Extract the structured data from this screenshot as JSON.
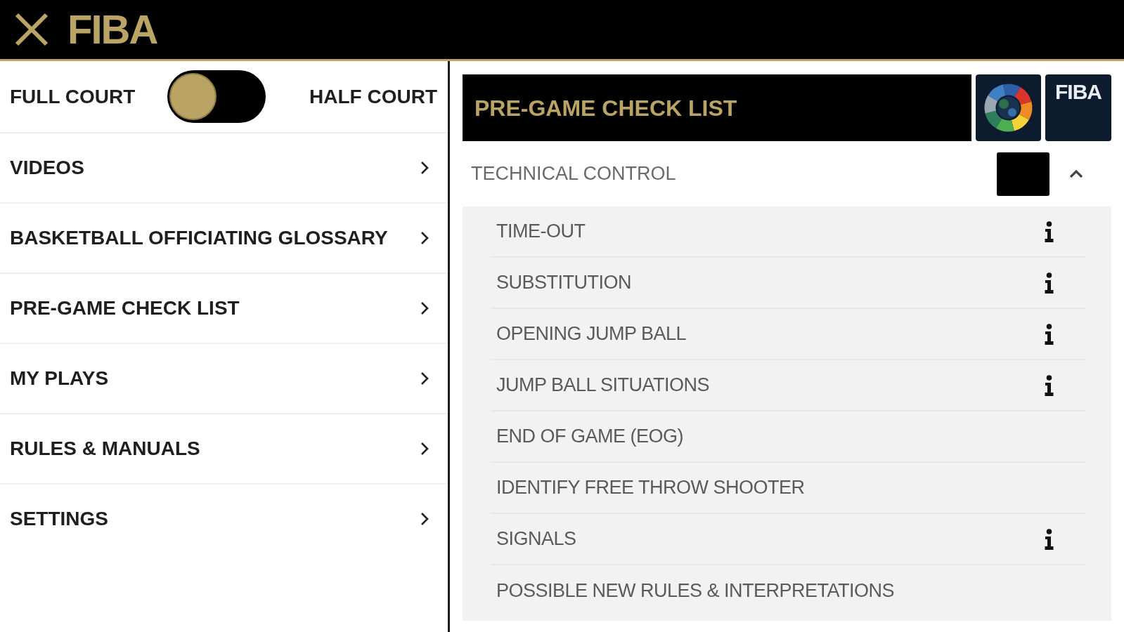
{
  "header": {
    "logo_text": "FIBA"
  },
  "court_toggle": {
    "left_label": "FULL COURT",
    "right_label": "HALF COURT",
    "on": false
  },
  "menu": [
    {
      "label": "VIDEOS"
    },
    {
      "label": "BASKETBALL OFFICIATING GLOSSARY"
    },
    {
      "label": "PRE-GAME CHECK LIST"
    },
    {
      "label": "MY PLAYS"
    },
    {
      "label": "RULES & MANUALS"
    },
    {
      "label": "SETTINGS"
    }
  ],
  "panel": {
    "title": "PRE-GAME CHECK LIST",
    "logo_badge": "FIBA",
    "section": {
      "label": "TECHNICAL CONTROL",
      "expanded": true,
      "items": [
        {
          "label": "TIME-OUT",
          "info": true
        },
        {
          "label": "SUBSTITUTION",
          "info": true
        },
        {
          "label": "OPENING JUMP BALL",
          "info": true
        },
        {
          "label": "JUMP BALL SITUATIONS",
          "info": true
        },
        {
          "label": "END OF GAME (EOG)",
          "info": false
        },
        {
          "label": "IDENTIFY FREE THROW SHOOTER",
          "info": false
        },
        {
          "label": "SIGNALS",
          "info": true
        },
        {
          "label": "POSSIBLE NEW RULES & INTERPRETATIONS",
          "info": false
        }
      ]
    }
  }
}
